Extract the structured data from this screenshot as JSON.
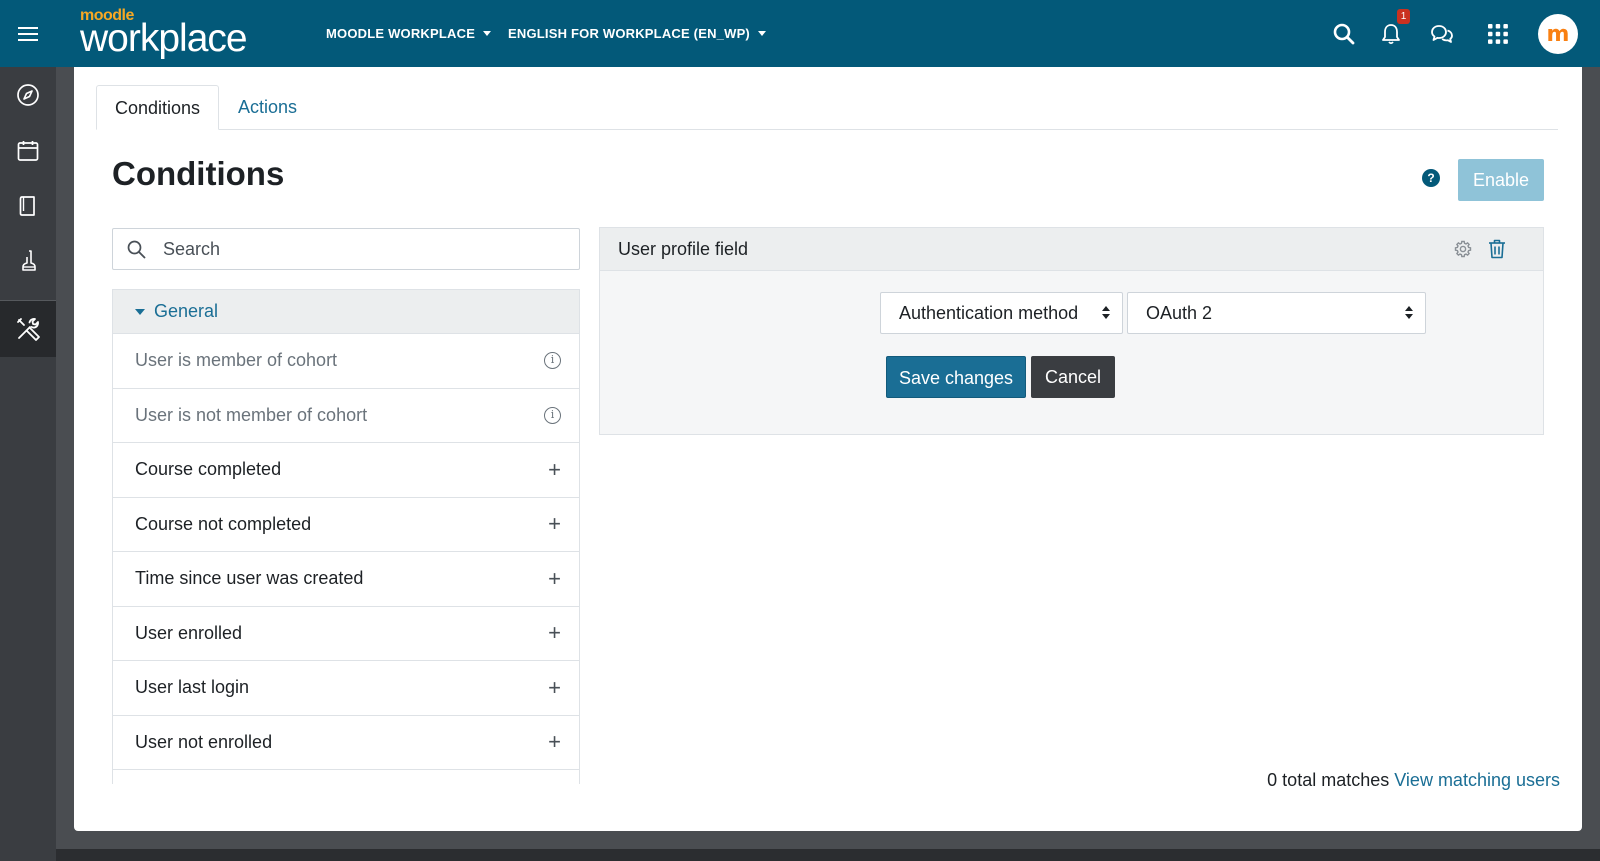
{
  "header": {
    "brand_small": "moodle",
    "brand_big": "workplace",
    "menu_tenant": "MOODLE WORKPLACE",
    "menu_language": "ENGLISH FOR WORKPLACE (EN_WP)",
    "notification_count": "1",
    "avatar_letter": "m"
  },
  "tabs": [
    {
      "label": "Conditions",
      "active": true
    },
    {
      "label": "Actions",
      "active": false
    }
  ],
  "page": {
    "title": "Conditions",
    "help_label": "?",
    "enable_label": "Enable"
  },
  "search": {
    "placeholder": "Search"
  },
  "conditions": {
    "group_label": "General",
    "items": [
      {
        "label": "User is member of cohort",
        "state": "info"
      },
      {
        "label": "User is not member of cohort",
        "state": "info"
      },
      {
        "label": "Course completed",
        "state": "add"
      },
      {
        "label": "Course not completed",
        "state": "add"
      },
      {
        "label": "Time since user was created",
        "state": "add"
      },
      {
        "label": "User enrolled",
        "state": "add"
      },
      {
        "label": "User last login",
        "state": "add"
      },
      {
        "label": "User not enrolled",
        "state": "add"
      }
    ],
    "add_symbol": "+",
    "info_symbol": "i"
  },
  "rule": {
    "title": "User profile field",
    "field_select": "Authentication method",
    "value_select": "OAuth 2",
    "save_label": "Save changes",
    "cancel_label": "Cancel"
  },
  "footer": {
    "matches_text": "0 total matches",
    "view_link": "View matching users"
  },
  "colors": {
    "navbar": "#035979",
    "link": "#1a6e95",
    "primary_button": "#1a6e95",
    "enable_button": "#8fc3d8"
  }
}
